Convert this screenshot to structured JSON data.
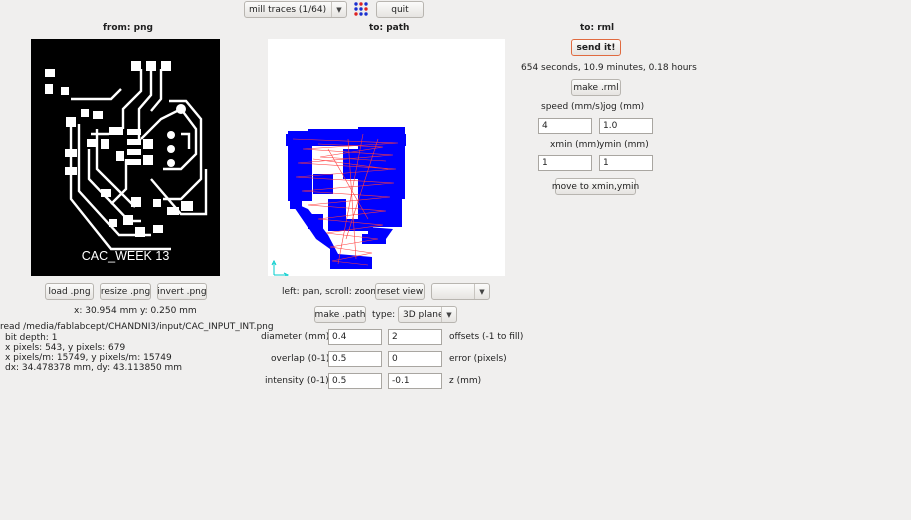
{
  "toolbar": {
    "process_select": "mill traces (1/64)",
    "quit_label": "quit",
    "grid_icon": "apps-grid-icon"
  },
  "png_panel": {
    "header": "from: png",
    "board_label": "CAC_WEEK 13",
    "buttons": {
      "load": "load .png",
      "resize": "resize .png",
      "invert": "invert .png"
    },
    "coords": "x: 30.954 mm  y: 0.250 mm",
    "info": [
      "read /media/fablabcept/CHANDNI3/input/CAC_INPUT_INT.png",
      "bit depth: 1",
      "x pixels: 543, y pixels: 679",
      "x pixels/m: 15749, y pixels/m: 15749",
      "dx: 34.478378 mm, dy: 43.113850 mm"
    ]
  },
  "path_panel": {
    "header": "to: path",
    "nav_hint": "left: pan, scroll: zoom",
    "reset_view": "reset view",
    "view_select": "",
    "make_path": "make .path",
    "type_label": "type:",
    "type_value": "3D plane",
    "params": {
      "diameter_label": "diameter (mm)",
      "diameter": "0.4",
      "offsets_label": "offsets (-1 to fill)",
      "offsets": "2",
      "overlap_label": "overlap (0-1)",
      "overlap": "0.5",
      "error_label": "error (pixels)",
      "error": "0",
      "intensity_label": "intensity (0-1)",
      "intensity": "0.5",
      "z_label": "z (mm)",
      "z": "-0.1"
    }
  },
  "rml_panel": {
    "header": "to: rml",
    "send_label": "send it!",
    "estimate": "654 seconds, 10.9 minutes, 0.18 hours",
    "make_rml": "make .rml",
    "speed_label": "speed (mm/s)",
    "speed": "4",
    "jog_label": "jog (mm)",
    "jog": "1.0",
    "xmin_label": "xmin (mm)",
    "xmin": "1",
    "ymin_label": "ymin (mm)",
    "ymin": "1",
    "move_label": "move to xmin,ymin"
  },
  "colors": {
    "background": "#f0efee",
    "accent_border": "#e06a3f",
    "toolpath_blue": "#0000ff",
    "toolpath_red": "#ff3030",
    "axis_cyan": "#00cccc"
  }
}
